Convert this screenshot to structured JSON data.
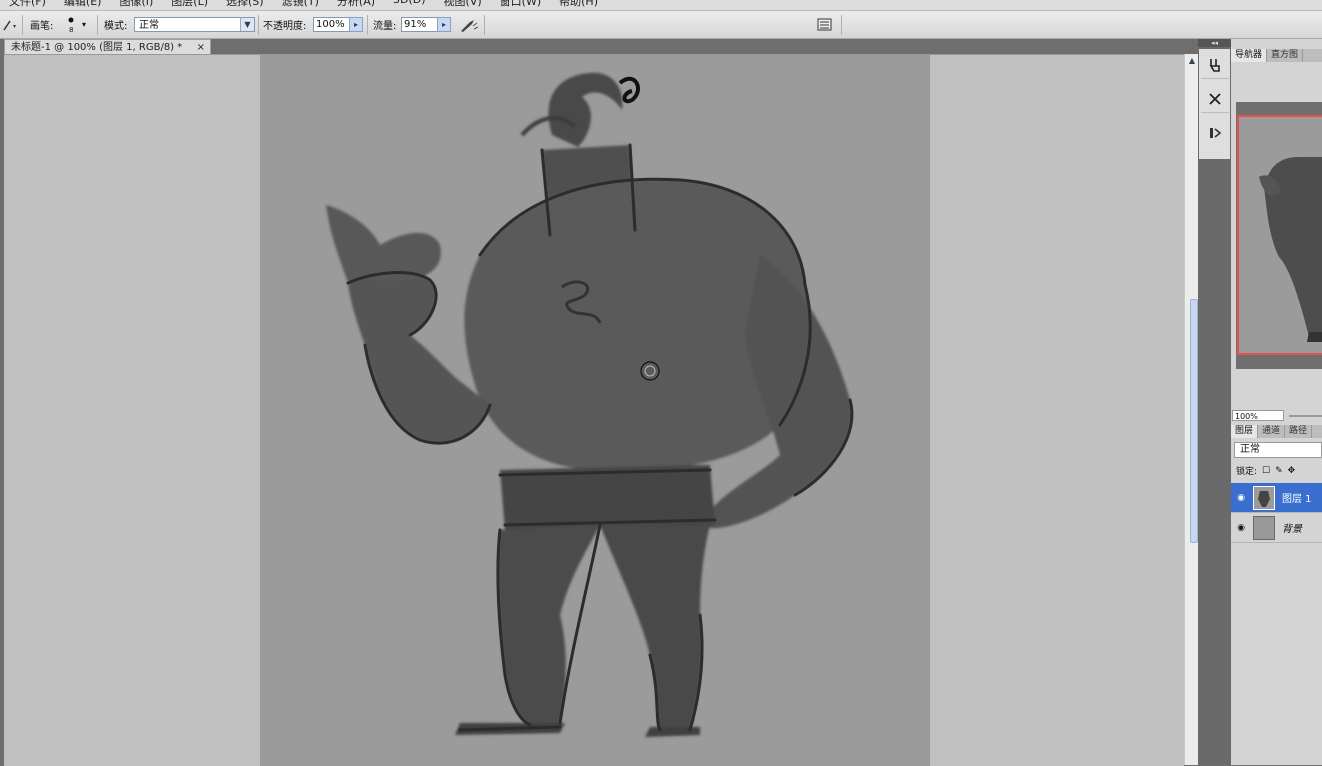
{
  "menu": {
    "items": [
      "文件(F)",
      "编辑(E)",
      "图像(I)",
      "图层(L)",
      "选择(S)",
      "滤镜(T)",
      "分析(A)",
      "3D(D)",
      "视图(V)",
      "窗口(W)",
      "帮助(H)"
    ]
  },
  "options": {
    "brush_label": "画笔:",
    "brush_size": "8",
    "mode_label": "模式:",
    "mode_value": "正常",
    "opacity_label": "不透明度:",
    "opacity_value": "100%",
    "flow_label": "流量:",
    "flow_value": "91%"
  },
  "document": {
    "tab_title": "未标题-1 @ 100% (图层 1, RGB/8) *",
    "close": "×"
  },
  "navigator": {
    "tabs": [
      "导航器",
      "直方图"
    ],
    "zoom": "100%"
  },
  "layers": {
    "tabs": [
      "图层",
      "通道",
      "路径"
    ],
    "blend_mode": "正常",
    "lock_label": "锁定:",
    "items": [
      {
        "name": "图层 1",
        "selected": true
      },
      {
        "name": "背景",
        "selected": false
      }
    ]
  },
  "dock": {
    "collapse": "◂◂"
  }
}
